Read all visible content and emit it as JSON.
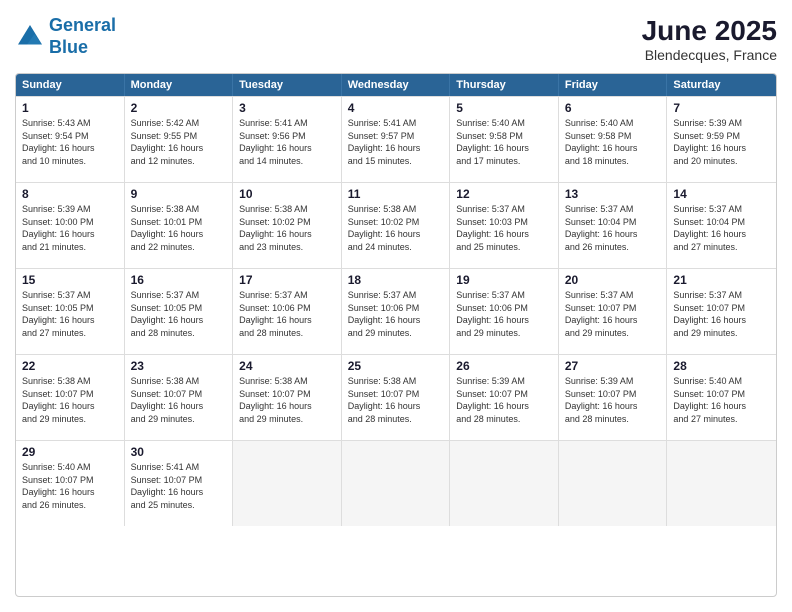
{
  "logo": {
    "line1": "General",
    "line2": "Blue"
  },
  "title": "June 2025",
  "location": "Blendecques, France",
  "header": {
    "days": [
      "Sunday",
      "Monday",
      "Tuesday",
      "Wednesday",
      "Thursday",
      "Friday",
      "Saturday"
    ]
  },
  "rows": [
    [
      {
        "day": "1",
        "text": "Sunrise: 5:43 AM\nSunset: 9:54 PM\nDaylight: 16 hours\nand 10 minutes."
      },
      {
        "day": "2",
        "text": "Sunrise: 5:42 AM\nSunset: 9:55 PM\nDaylight: 16 hours\nand 12 minutes."
      },
      {
        "day": "3",
        "text": "Sunrise: 5:41 AM\nSunset: 9:56 PM\nDaylight: 16 hours\nand 14 minutes."
      },
      {
        "day": "4",
        "text": "Sunrise: 5:41 AM\nSunset: 9:57 PM\nDaylight: 16 hours\nand 15 minutes."
      },
      {
        "day": "5",
        "text": "Sunrise: 5:40 AM\nSunset: 9:58 PM\nDaylight: 16 hours\nand 17 minutes."
      },
      {
        "day": "6",
        "text": "Sunrise: 5:40 AM\nSunset: 9:58 PM\nDaylight: 16 hours\nand 18 minutes."
      },
      {
        "day": "7",
        "text": "Sunrise: 5:39 AM\nSunset: 9:59 PM\nDaylight: 16 hours\nand 20 minutes."
      }
    ],
    [
      {
        "day": "8",
        "text": "Sunrise: 5:39 AM\nSunset: 10:00 PM\nDaylight: 16 hours\nand 21 minutes."
      },
      {
        "day": "9",
        "text": "Sunrise: 5:38 AM\nSunset: 10:01 PM\nDaylight: 16 hours\nand 22 minutes."
      },
      {
        "day": "10",
        "text": "Sunrise: 5:38 AM\nSunset: 10:02 PM\nDaylight: 16 hours\nand 23 minutes."
      },
      {
        "day": "11",
        "text": "Sunrise: 5:38 AM\nSunset: 10:02 PM\nDaylight: 16 hours\nand 24 minutes."
      },
      {
        "day": "12",
        "text": "Sunrise: 5:37 AM\nSunset: 10:03 PM\nDaylight: 16 hours\nand 25 minutes."
      },
      {
        "day": "13",
        "text": "Sunrise: 5:37 AM\nSunset: 10:04 PM\nDaylight: 16 hours\nand 26 minutes."
      },
      {
        "day": "14",
        "text": "Sunrise: 5:37 AM\nSunset: 10:04 PM\nDaylight: 16 hours\nand 27 minutes."
      }
    ],
    [
      {
        "day": "15",
        "text": "Sunrise: 5:37 AM\nSunset: 10:05 PM\nDaylight: 16 hours\nand 27 minutes."
      },
      {
        "day": "16",
        "text": "Sunrise: 5:37 AM\nSunset: 10:05 PM\nDaylight: 16 hours\nand 28 minutes."
      },
      {
        "day": "17",
        "text": "Sunrise: 5:37 AM\nSunset: 10:06 PM\nDaylight: 16 hours\nand 28 minutes."
      },
      {
        "day": "18",
        "text": "Sunrise: 5:37 AM\nSunset: 10:06 PM\nDaylight: 16 hours\nand 29 minutes."
      },
      {
        "day": "19",
        "text": "Sunrise: 5:37 AM\nSunset: 10:06 PM\nDaylight: 16 hours\nand 29 minutes."
      },
      {
        "day": "20",
        "text": "Sunrise: 5:37 AM\nSunset: 10:07 PM\nDaylight: 16 hours\nand 29 minutes."
      },
      {
        "day": "21",
        "text": "Sunrise: 5:37 AM\nSunset: 10:07 PM\nDaylight: 16 hours\nand 29 minutes."
      }
    ],
    [
      {
        "day": "22",
        "text": "Sunrise: 5:38 AM\nSunset: 10:07 PM\nDaylight: 16 hours\nand 29 minutes."
      },
      {
        "day": "23",
        "text": "Sunrise: 5:38 AM\nSunset: 10:07 PM\nDaylight: 16 hours\nand 29 minutes."
      },
      {
        "day": "24",
        "text": "Sunrise: 5:38 AM\nSunset: 10:07 PM\nDaylight: 16 hours\nand 29 minutes."
      },
      {
        "day": "25",
        "text": "Sunrise: 5:38 AM\nSunset: 10:07 PM\nDaylight: 16 hours\nand 28 minutes."
      },
      {
        "day": "26",
        "text": "Sunrise: 5:39 AM\nSunset: 10:07 PM\nDaylight: 16 hours\nand 28 minutes."
      },
      {
        "day": "27",
        "text": "Sunrise: 5:39 AM\nSunset: 10:07 PM\nDaylight: 16 hours\nand 28 minutes."
      },
      {
        "day": "28",
        "text": "Sunrise: 5:40 AM\nSunset: 10:07 PM\nDaylight: 16 hours\nand 27 minutes."
      }
    ],
    [
      {
        "day": "29",
        "text": "Sunrise: 5:40 AM\nSunset: 10:07 PM\nDaylight: 16 hours\nand 26 minutes."
      },
      {
        "day": "30",
        "text": "Sunrise: 5:41 AM\nSunset: 10:07 PM\nDaylight: 16 hours\nand 25 minutes."
      },
      {
        "day": "",
        "text": ""
      },
      {
        "day": "",
        "text": ""
      },
      {
        "day": "",
        "text": ""
      },
      {
        "day": "",
        "text": ""
      },
      {
        "day": "",
        "text": ""
      }
    ]
  ]
}
